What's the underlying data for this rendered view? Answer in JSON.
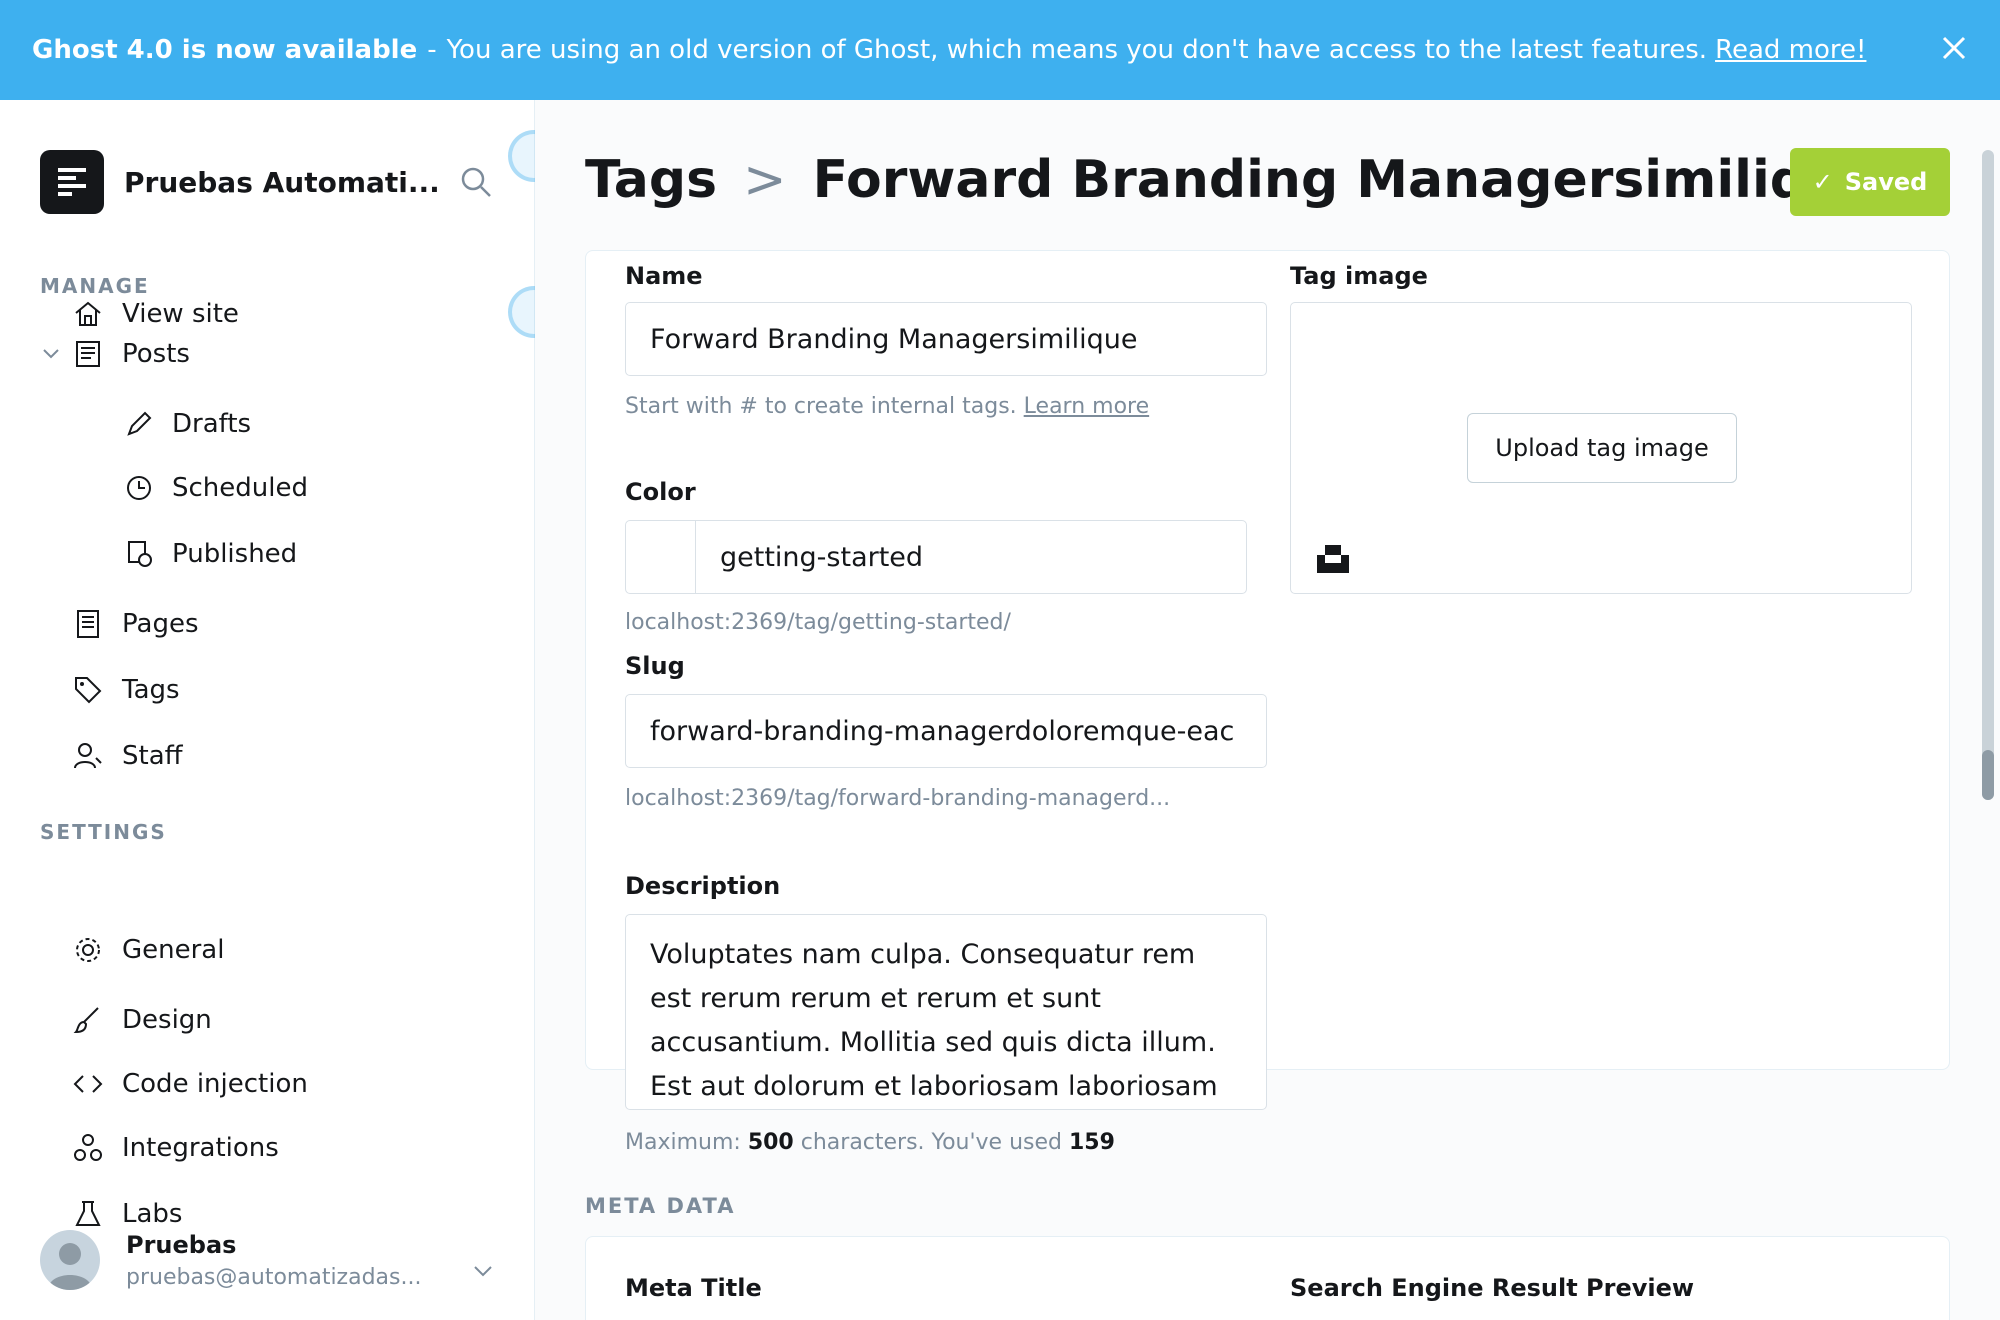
{
  "banner": {
    "title": "Ghost 4.0 is now available",
    "separator": "-",
    "message": "You are using an old version of Ghost, which means you don't have access to the latest features.",
    "link": "Read more!",
    "close_icon": "close-icon"
  },
  "sidebar": {
    "brand": "Pruebas Automati...",
    "headings": {
      "manage": "MANAGE",
      "settings": "SETTINGS"
    },
    "items": {
      "view_site": "View site",
      "posts": "Posts",
      "drafts": "Drafts",
      "scheduled": "Scheduled",
      "published": "Published",
      "pages": "Pages",
      "tags": "Tags",
      "staff": "Staff",
      "general": "General",
      "design": "Design",
      "code_injection": "Code injection",
      "integrations": "Integrations",
      "labs": "Labs"
    },
    "user": {
      "name": "Pruebas",
      "email": "pruebas@automatizadas..."
    }
  },
  "header": {
    "parent": "Tags",
    "separator": ">",
    "current": "Forward Branding Managersimilique",
    "saved_label": "Saved"
  },
  "form": {
    "name_label": "Name",
    "name_value": "Forward Branding Managersimilique",
    "name_hint": "Start with # to create internal tags.",
    "name_hint_link": "Learn more",
    "color_label": "Color",
    "color_value": "getting-started",
    "slug_label": "Slug",
    "slug_value": "forward-branding-managerdoloremque-eac",
    "slug_url": "localhost:2369/tag/forward-branding-managerd...",
    "color_url": "localhost:2369/tag/getting-started/",
    "description_label": "Description",
    "description_value": "Voluptates nam culpa. Consequatur rem est rerum rerum et rerum et sunt accusantium. Mollitia sed quis dicta illum. Est aut dolorum et laboriosam laboriosam",
    "max_prefix": "Maximum:",
    "max_value": "500",
    "max_mid": "characters. You've used",
    "used_value": "159",
    "image_label": "Tag image",
    "upload_label": "Upload tag image"
  },
  "meta": {
    "heading": "META DATA",
    "title_label": "Meta Title",
    "preview_label": "Search Engine Result Preview"
  },
  "colors": {
    "banner": "#3eb0ef",
    "saved": "#a4d037",
    "text": "#15171a",
    "muted": "#7c8b9a"
  }
}
